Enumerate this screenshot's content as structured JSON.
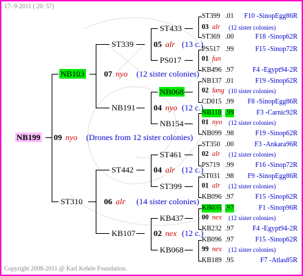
{
  "header": {
    "stamp": "17- 9-2011 ( 20: 57)"
  },
  "footer": {
    "copyright": "Copyright 2008-2011 @ Karl Kehrle Foundation."
  },
  "root": {
    "id": "NB199",
    "year": "09",
    "mark": "nyo",
    "note": "(Drones from 12 sister colonies)"
  },
  "gen1": [
    {
      "id": "NB103",
      "year": "07",
      "mark": "nyo",
      "note": "(12 sister colonies)",
      "highlight": true
    },
    {
      "id": "ST310",
      "year": "06",
      "mark": "alr",
      "note": "(14 sister colonies)",
      "highlight": false
    }
  ],
  "gen2": [
    {
      "id": "ST339",
      "year": "05",
      "mark": "alr",
      "note": "(13 c.)"
    },
    {
      "id": "NB191",
      "year": "04",
      "mark": "nyo",
      "note": "(12 c.)"
    },
    {
      "id": "ST442",
      "year": "04",
      "mark": "alr",
      "note": "(12 c.)"
    },
    {
      "id": "KB107",
      "year": "02",
      "mark": "nex",
      "note": "(12 c.)"
    }
  ],
  "gen3": [
    {
      "id": "ST433",
      "highlight": false
    },
    {
      "id": "PS017",
      "highlight": false
    },
    {
      "id": "NB068",
      "highlight": true
    },
    {
      "id": "NB154",
      "highlight": false
    },
    {
      "id": "ST461",
      "highlight": false
    },
    {
      "id": "ST399",
      "highlight": false
    },
    {
      "id": "KB437",
      "highlight": false
    },
    {
      "id": "KB068",
      "highlight": false
    }
  ],
  "gen4": [
    {
      "id": "ST399",
      "val": ".01",
      "loc": "F10 -SinopEgg86R",
      "highlight": false
    },
    {
      "year": "03",
      "mark": "alr",
      "note": "(12 sister colonies)"
    },
    {
      "id": "ST369",
      "val": ".00",
      "loc": "F18 -Sinop62R",
      "highlight": false
    },
    {
      "id": "PS517",
      "val": ".99",
      "loc": "F15 -Sinop72R",
      "highlight": false
    },
    {
      "year": "01",
      "mark": "fun",
      "note": ""
    },
    {
      "id": "KB496",
      "val": ".97",
      "loc": "F4 -Egypt94-2R",
      "highlight": false
    },
    {
      "id": "NB137",
      "val": ".01",
      "loc": "F19 -Sinop62R",
      "highlight": false
    },
    {
      "year": "02",
      "mark": "lang",
      "note": "(10 sister colonies)"
    },
    {
      "id": "CD015",
      "val": ".99",
      "loc": "F8 -SinopEgg86R",
      "highlight": false
    },
    {
      "id": "NB110",
      "val": ".99",
      "loc": "F3 -Carnic92R",
      "highlight": true
    },
    {
      "year": "01",
      "mark": "nyo",
      "note": "(12 sister colonies)"
    },
    {
      "id": "NB099",
      "val": ".98",
      "loc": "F19 -Sinop62R",
      "highlight": false
    },
    {
      "id": "ST350",
      "val": ".00",
      "loc": "F3 -Ankara96R",
      "highlight": false
    },
    {
      "year": "02",
      "mark": "alr",
      "note": "(12 sister colonies)"
    },
    {
      "id": "PS719",
      "val": ".99",
      "loc": "F16 -Sinop72R",
      "highlight": false
    },
    {
      "id": "ST031",
      "val": ".98",
      "loc": "F9 -SinopEgg86R",
      "highlight": false
    },
    {
      "year": "01",
      "mark": "alr",
      "note": "(12 sister colonies)"
    },
    {
      "id": "KB096",
      "val": ".97",
      "loc": "F15 -Sinop62R",
      "highlight": false
    },
    {
      "id": "KB035",
      "val": ".97",
      "loc": "F1 -Sinop96R",
      "highlight": true
    },
    {
      "year": "00",
      "mark": "nex",
      "note": "(12 sister colonies)"
    },
    {
      "id": "KB232",
      "val": ".97",
      "loc": "F4 -Egypt94-2R",
      "highlight": false
    },
    {
      "id": "KB096",
      "val": ".97",
      "loc": "F15 -Sinop62R",
      "highlight": false
    },
    {
      "year": "99",
      "mark": "nex",
      "note": "(12 sister colonies)"
    },
    {
      "id": "KB189",
      "val": ".95",
      "loc": "F7 -Atlas85R",
      "highlight": false
    }
  ]
}
